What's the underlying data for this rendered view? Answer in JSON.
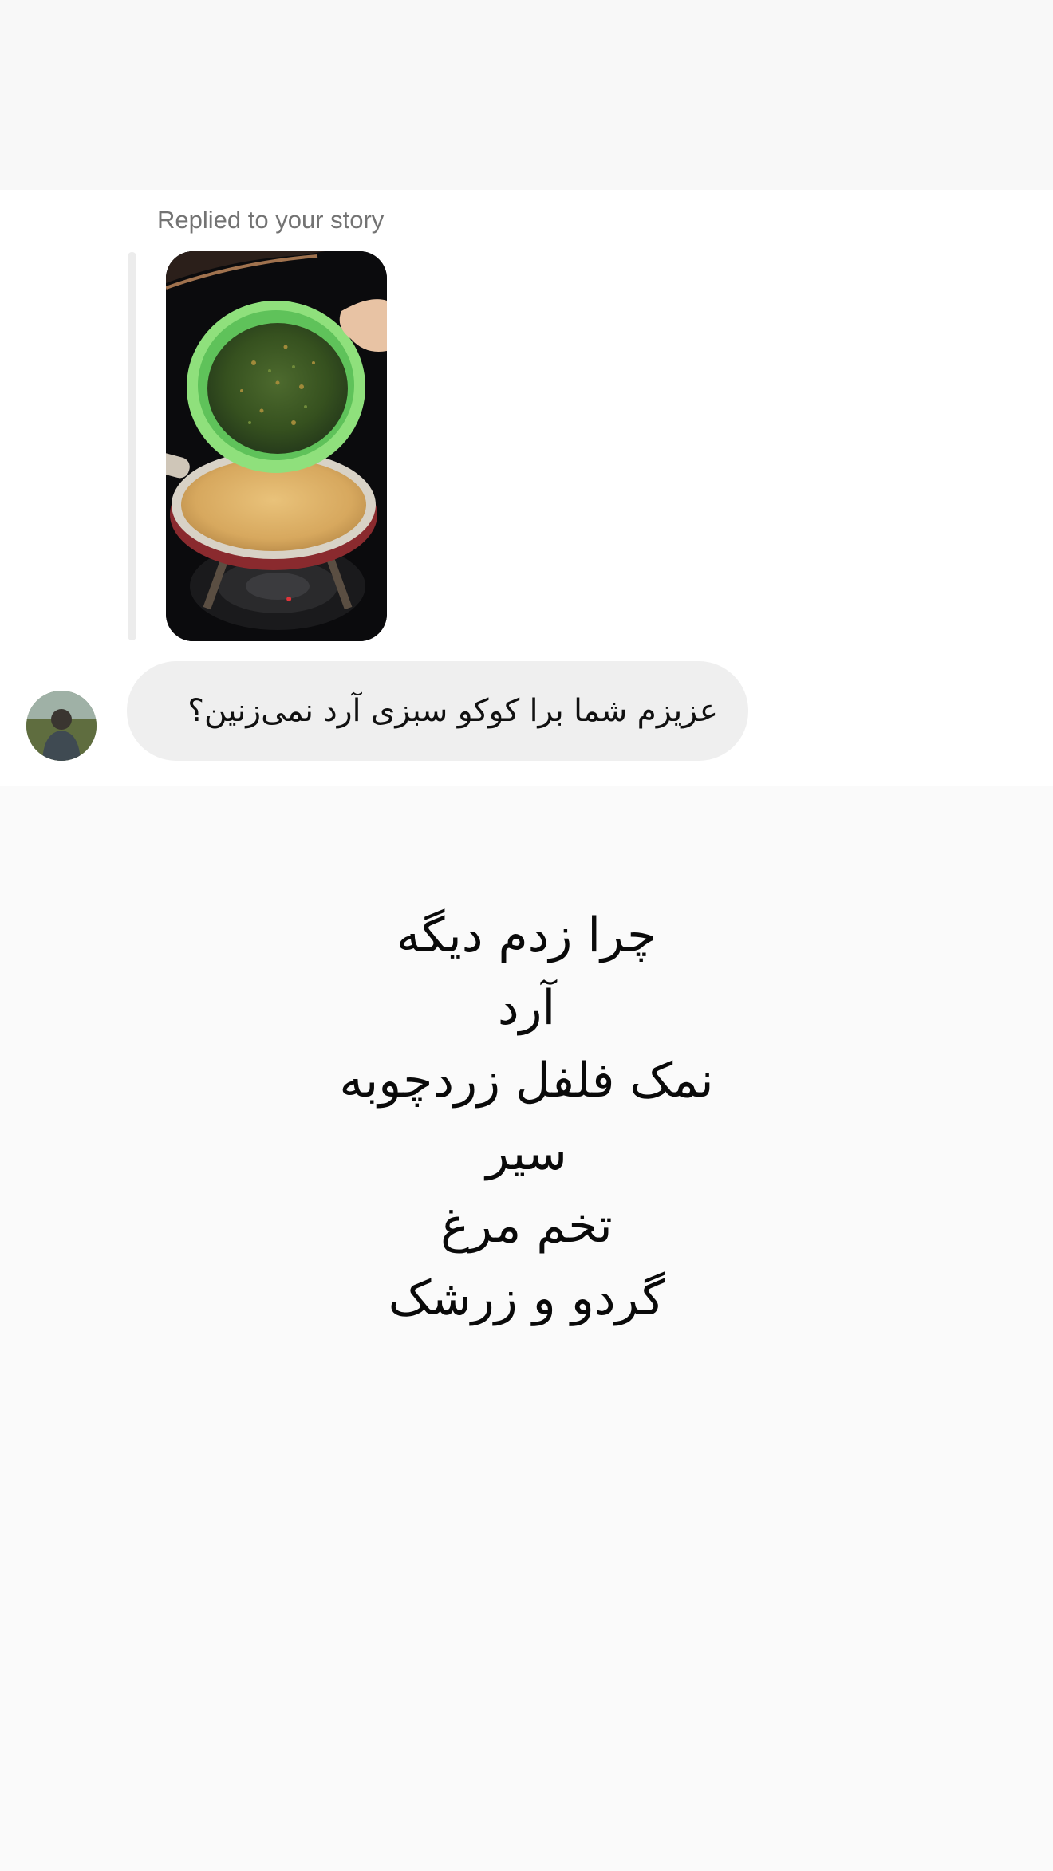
{
  "thread": {
    "reply_label": "Replied to your story",
    "story": {
      "image": "story-photo"
    },
    "avatar": {
      "image": "user-avatar"
    },
    "message": "عزیزم شما برا کوکو سبزی آرد نمی‌زنین؟"
  },
  "reply_overlay": {
    "lines": [
      "چرا زدم دیگه",
      "آرد",
      "نمک فلفل زردچوبه",
      "سیر",
      "تخم مرغ",
      "گردو و زرشک"
    ]
  },
  "colors": {
    "page_background": "#fafafa",
    "panel_background": "#ffffff",
    "bubble_background": "#efefef",
    "label_gray": "#737373",
    "text_dark": "#111111"
  }
}
